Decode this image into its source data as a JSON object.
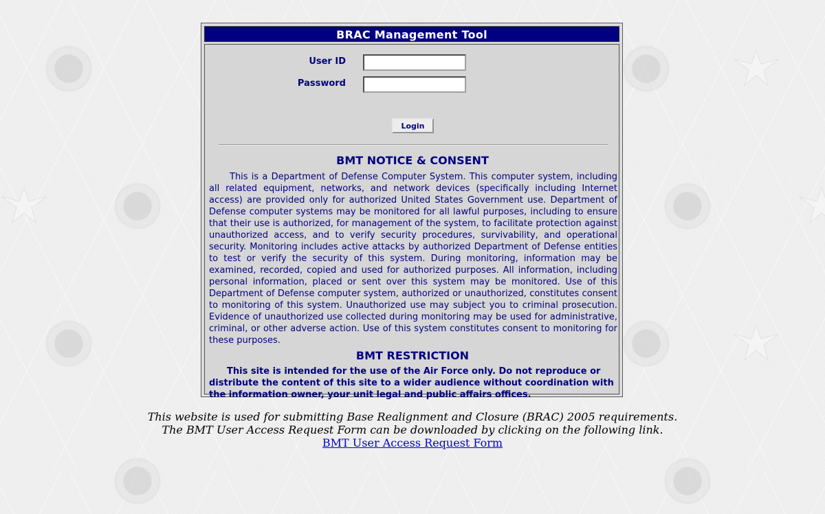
{
  "app": {
    "title": "BRAC Management Tool"
  },
  "login": {
    "user_id_label": "User ID",
    "user_id_value": "",
    "password_label": "Password",
    "password_value": "",
    "login_button": "Login"
  },
  "notice": {
    "heading": "BMT NOTICE & CONSENT",
    "body": "This is a Department of Defense Computer System. This computer system, including all related equipment, networks, and network devices (specifically including Internet access) are provided only for authorized United States Government use. Department of Defense computer systems may be monitored for all lawful purposes, including to ensure that their use is authorized, for management of the system, to facilitate protection against unauthorized access, and to verify security procedures, survivability, and operational security. Monitoring includes active attacks by authorized Department of Defense entities to test or verify the security of this system. During monitoring, information may be examined, recorded, copied and used for authorized purposes. All information, including personal information, placed or sent over this system may be monitored. Use of this Department of Defense computer system, authorized or unauthorized, constitutes consent to monitoring of this system. Unauthorized use may subject you to criminal prosecution. Evidence of unauthorized use collected during monitoring may be used for administrative, criminal, or other adverse action. Use of this system constitutes consent to monitoring for these purposes."
  },
  "restriction": {
    "heading": "BMT RESTRICTION",
    "body": "This site is intended for the use of the Air Force only. Do not reproduce or distribute the content of this site to a wider audience without coordination with the information owner, your unit legal and public affairs offices."
  },
  "footer": {
    "line1": "This website is used for submitting Base Realignment and Closure (BRAC) 2005 requirements.",
    "line2": "The BMT User Access Request Form can be downloaded by clicking on the following link.",
    "link_text": "BMT User Access Request Form"
  },
  "colors": {
    "title_bar": "#000080",
    "text": "#000080",
    "panel": "#d6d6d6",
    "link": "#0000cc"
  },
  "icons": {
    "background_seal": "air-force-seal-watermark",
    "background_wing": "air-force-wings-watermark"
  }
}
